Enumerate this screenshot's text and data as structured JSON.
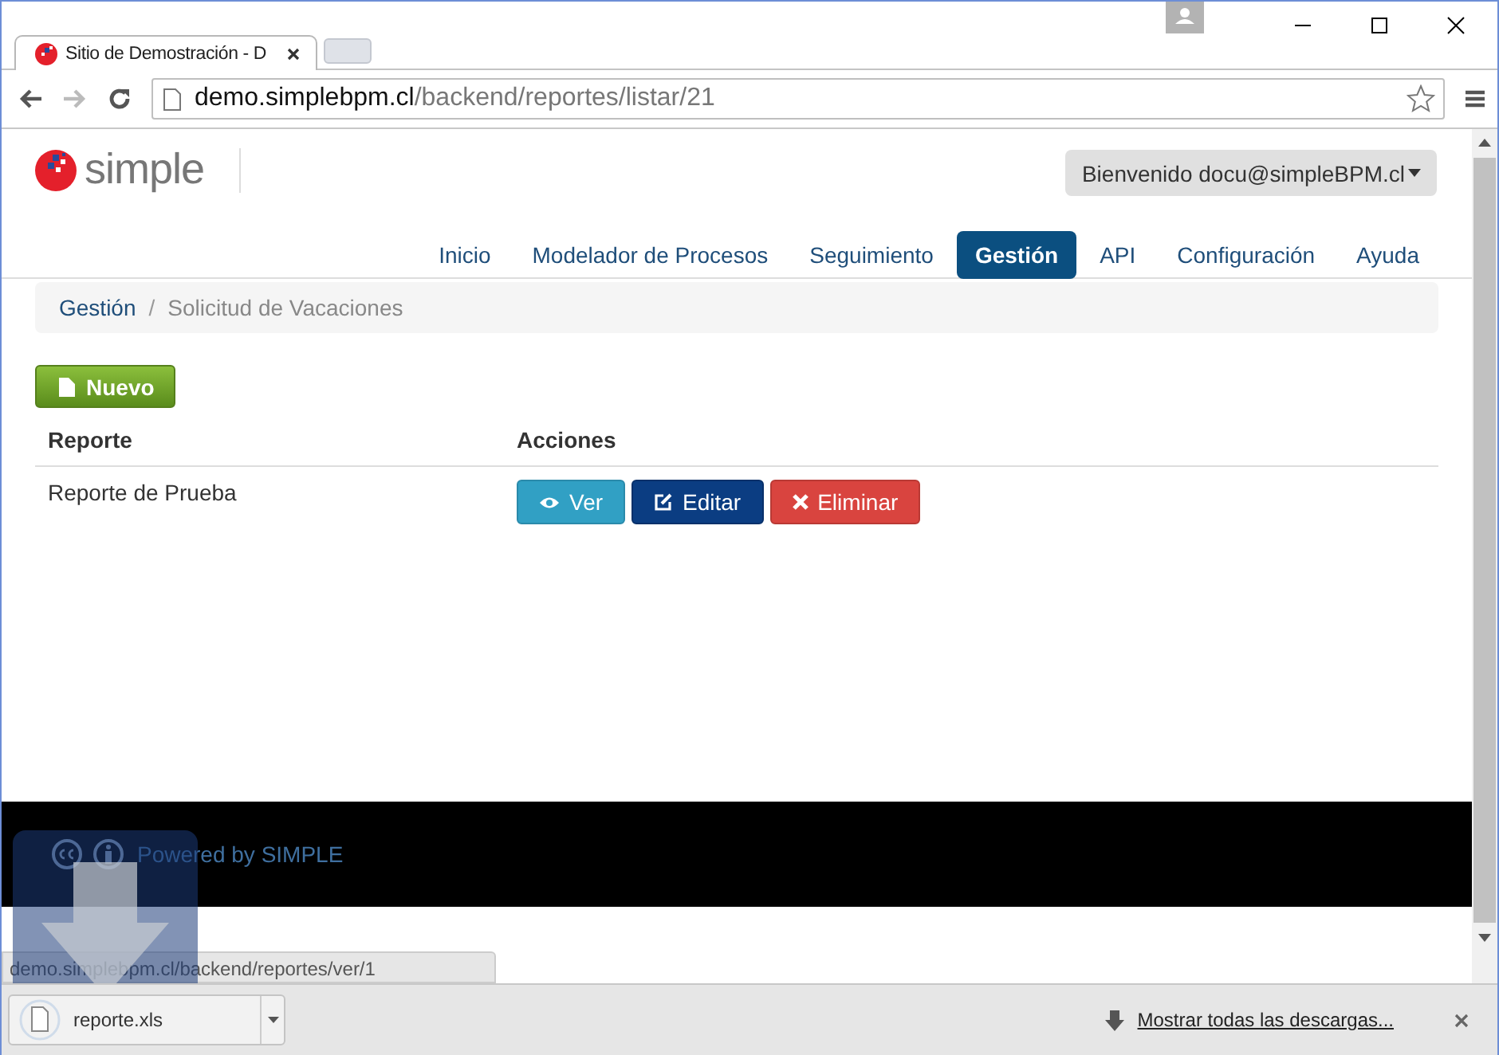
{
  "browser": {
    "tab_title": "Sitio de Demostración - D",
    "url_host": "demo.simplebpm.cl",
    "url_path": "/backend/reportes/listar/21",
    "status_url": "demo.simplebpm.cl/backend/reportes/ver/1"
  },
  "header": {
    "brand": "simple",
    "user_menu": "Bienvenido docu@simpleBPM.cl"
  },
  "nav": [
    {
      "label": "Inicio",
      "selected": false
    },
    {
      "label": "Modelador de Procesos",
      "selected": false
    },
    {
      "label": "Seguimiento",
      "selected": false
    },
    {
      "label": "Gestión",
      "selected": true
    },
    {
      "label": "API",
      "selected": false
    },
    {
      "label": "Configuración",
      "selected": false
    },
    {
      "label": "Ayuda",
      "selected": false
    }
  ],
  "breadcrumb_separator": "/",
  "breadcrumb": [
    {
      "label": "Gestión",
      "selected": false
    },
    {
      "label": "Solicitud de Vacaciones",
      "selected": true
    }
  ],
  "new_button": "Nuevo",
  "table": {
    "columns": [
      "Reporte",
      "Acciones"
    ],
    "rows": [
      {
        "name": "Reporte de Prueba",
        "actions": [
          {
            "label": "Ver",
            "kind": "view"
          },
          {
            "label": "Editar",
            "kind": "edit"
          },
          {
            "label": "Eliminar",
            "kind": "delete"
          }
        ]
      }
    ]
  },
  "footer": {
    "text": "Powered by SIMPLE"
  },
  "downloads": {
    "file": "reporte.xls",
    "show_all": "Mostrar todas las descargas..."
  }
}
